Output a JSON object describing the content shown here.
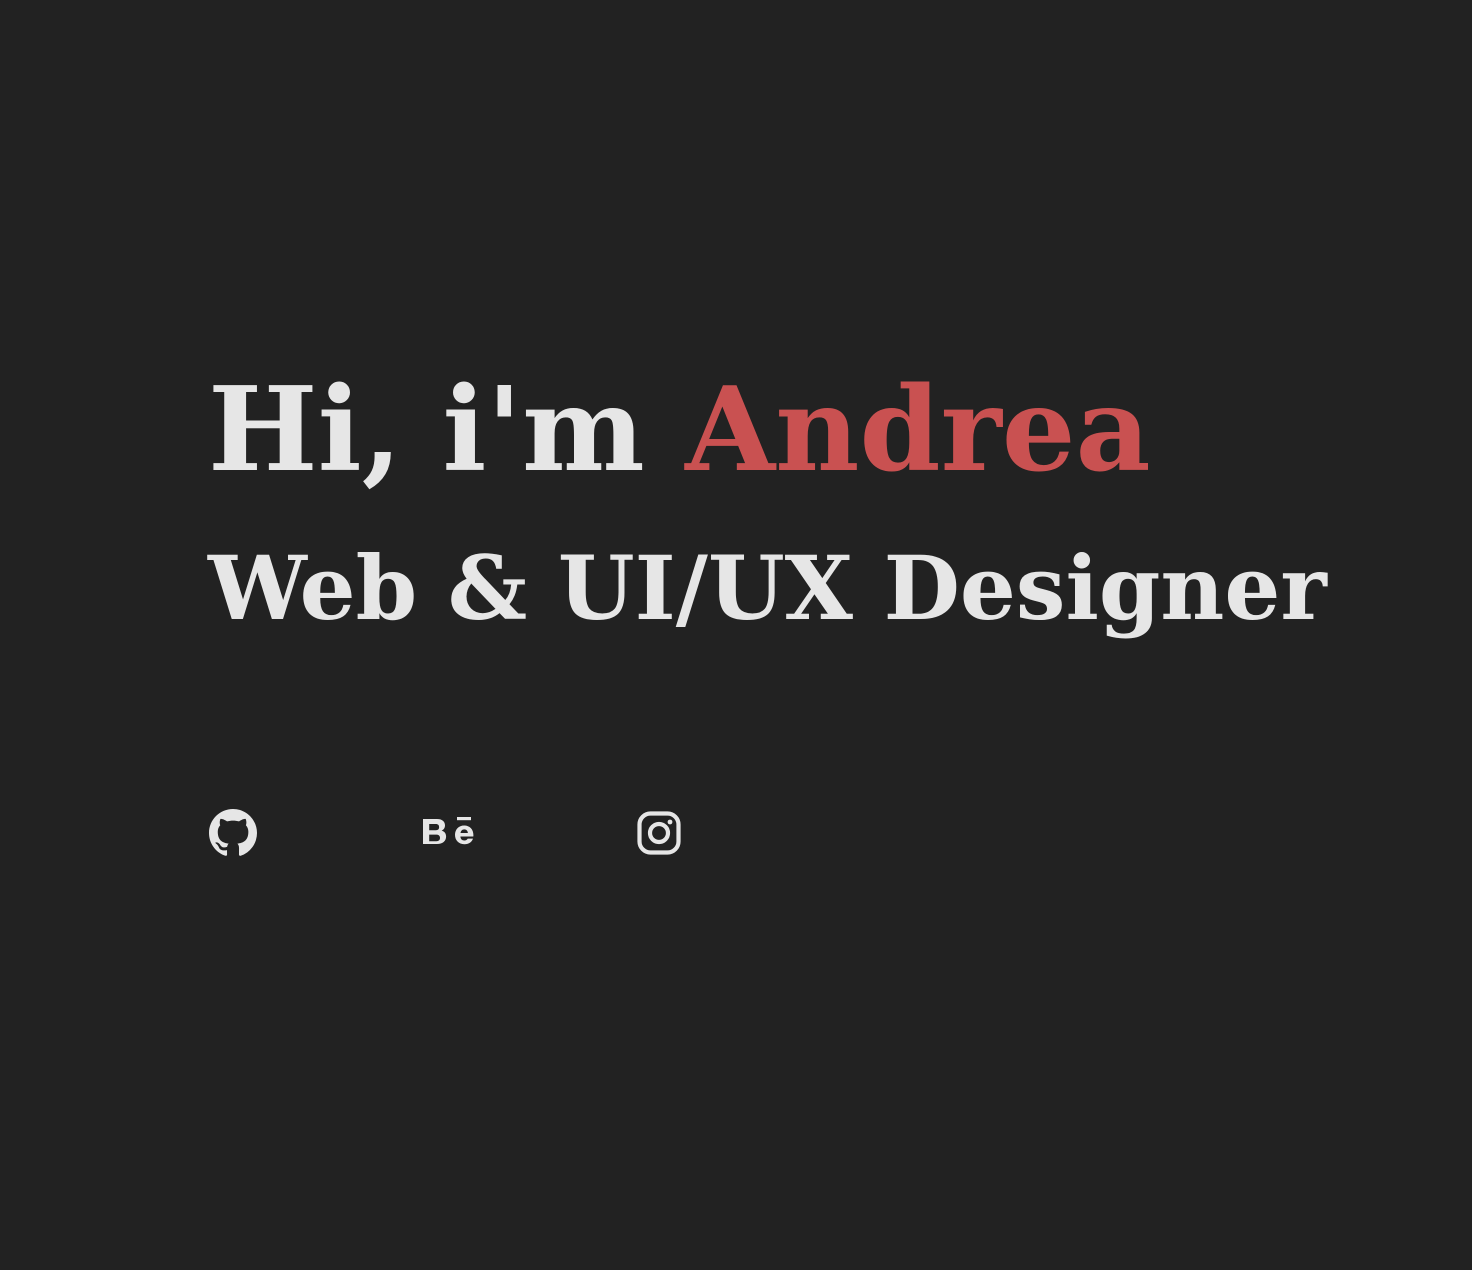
{
  "hero": {
    "greeting_prefix": "Hi, i'm ",
    "name": "Andrea",
    "role": "Web & UI/UX Designer"
  },
  "socials": [
    {
      "icon": "github-icon"
    },
    {
      "icon": "behance-icon"
    },
    {
      "icon": "instagram-icon"
    }
  ],
  "colors": {
    "background": "#222222",
    "text": "#e6e6e6",
    "accent": "#c95151"
  }
}
